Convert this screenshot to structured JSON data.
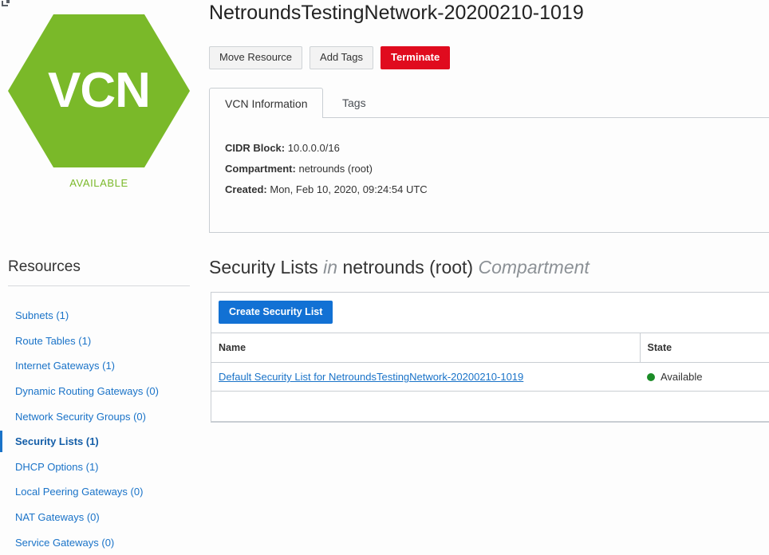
{
  "resource_badge": {
    "icon_label": "VCN",
    "icon_name": "vcn-hexagon-icon",
    "state_text": "AVAILABLE",
    "state_color": "#7ab929"
  },
  "header": {
    "title": "NetroundsTestingNetwork-20200210-1019",
    "actions": [
      {
        "label": "Move Resource",
        "style": "secondary"
      },
      {
        "label": "Add Tags",
        "style": "secondary"
      },
      {
        "label": "Terminate",
        "style": "danger",
        "color": "#e00b1e"
      }
    ]
  },
  "tabs": [
    {
      "label": "VCN Information",
      "active": true
    },
    {
      "label": "Tags",
      "active": false
    }
  ],
  "vcn_information": {
    "rows": [
      {
        "label": "CIDR Block:",
        "value": "10.0.0.0/16"
      },
      {
        "label": "Compartment:",
        "value": "netrounds (root)"
      },
      {
        "label": "Created:",
        "value": "Mon, Feb 10, 2020, 09:24:54 UTC"
      }
    ]
  },
  "sidebar": {
    "title": "Resources",
    "items": [
      {
        "label": "Subnets (1)",
        "selected": false
      },
      {
        "label": "Route Tables (1)",
        "selected": false
      },
      {
        "label": "Internet Gateways (1)",
        "selected": false
      },
      {
        "label": "Dynamic Routing Gateways (0)",
        "selected": false
      },
      {
        "label": "Network Security Groups (0)",
        "selected": false
      },
      {
        "label": "Security Lists (1)",
        "selected": true
      },
      {
        "label": "DHCP Options (1)",
        "selected": false
      },
      {
        "label": "Local Peering Gateways (0)",
        "selected": false
      },
      {
        "label": "NAT Gateways (0)",
        "selected": false
      },
      {
        "label": "Service Gateways (0)",
        "selected": false
      }
    ],
    "accent_color": "#1a73c8",
    "link_color": "#1a73c8"
  },
  "section": {
    "heading_part1": "Security Lists",
    "heading_in": "in",
    "heading_part2": "netrounds (root)",
    "heading_suffix": "Compartment"
  },
  "table": {
    "create_button": "Create Security List",
    "create_button_color": "#1271d4",
    "columns": [
      "Name",
      "State"
    ],
    "rows": [
      {
        "name": "Default Security List for NetroundsTestingNetwork-20200210-1019",
        "state": "Available",
        "state_color": "#1b8c27"
      }
    ]
  }
}
